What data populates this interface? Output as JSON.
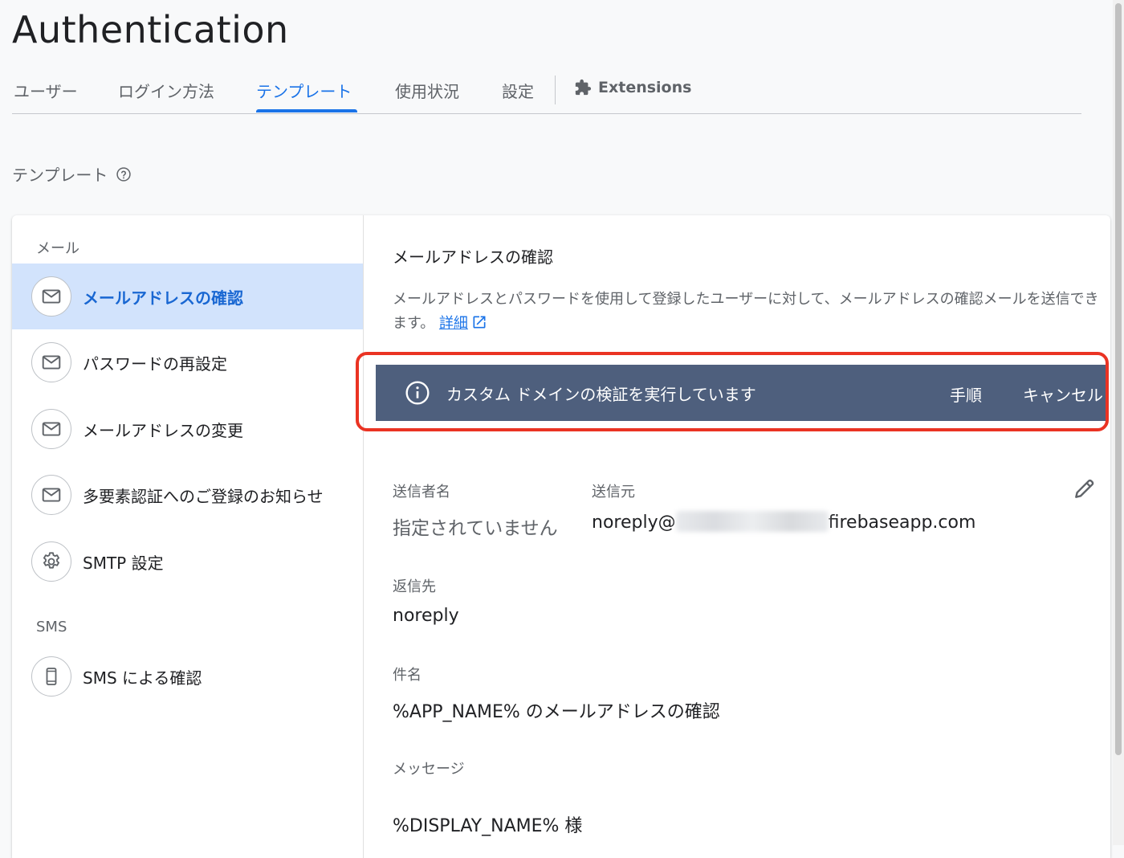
{
  "page": {
    "title": "Authentication"
  },
  "tabs": [
    {
      "label": "ユーザー"
    },
    {
      "label": "ログイン方法"
    },
    {
      "label": "テンプレート",
      "active": true
    },
    {
      "label": "使用状況"
    },
    {
      "label": "設定"
    }
  ],
  "extensions_tab": {
    "label": "Extensions",
    "icon": "puzzle-icon"
  },
  "section": {
    "heading": "テンプレート",
    "help_icon": "help-circle-icon"
  },
  "sidebar": {
    "email_group": "メール",
    "sms_group": "SMS",
    "items": [
      {
        "label": "メールアドレスの確認",
        "icon": "mail-icon",
        "active": true
      },
      {
        "label": "パスワードの再設定",
        "icon": "mail-icon"
      },
      {
        "label": "メールアドレスの変更",
        "icon": "mail-icon"
      },
      {
        "label": "多要素認証へのご登録のお知らせ",
        "icon": "mail-icon"
      },
      {
        "label": "SMTP 設定",
        "icon": "gear-icon"
      }
    ],
    "sms_items": [
      {
        "label": "SMS による確認",
        "icon": "phone-icon"
      }
    ]
  },
  "content": {
    "title": "メールアドレスの確認",
    "description": "メールアドレスとパスワードを使用して登録したユーザーに対して、メールアドレスの確認メールを送信できます。",
    "learn_more": "詳細"
  },
  "banner": {
    "text": "カスタム ドメインの検証を実行しています",
    "steps_button": "手順",
    "cancel_button": "キャンセル",
    "background": "#4e5f7d",
    "highlight_color": "#ea3323"
  },
  "fields": {
    "sender_name_label": "送信者名",
    "sender_name_value": "指定されていません",
    "from_label": "送信元",
    "from_prefix": "noreply@",
    "from_suffix": "firebaseapp.com",
    "reply_to_label": "返信先",
    "reply_to_value": "noreply",
    "subject_label": "件名",
    "subject_value": "%APP_NAME% のメールアドレスの確認",
    "message_label": "メッセージ",
    "message_value": "%DISPLAY_NAME% 様"
  },
  "colors": {
    "accent": "#1a73e8",
    "active_bg": "#d2e3fc"
  }
}
